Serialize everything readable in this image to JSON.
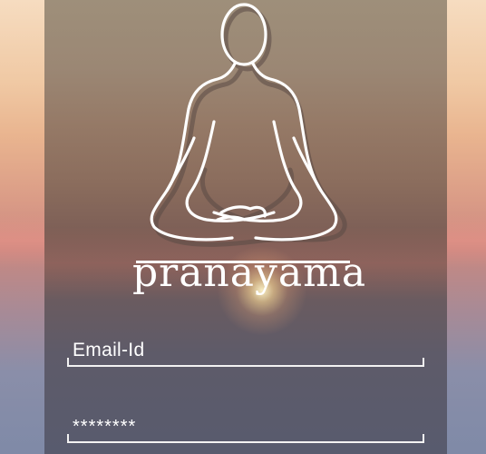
{
  "app": {
    "brand": "pranayama",
    "logo_icon": "meditating-person-icon"
  },
  "login": {
    "email_placeholder": "Email-Id",
    "password_value": "********"
  },
  "colors": {
    "text": "#ffffff",
    "field_line": "#f2f2f2"
  }
}
